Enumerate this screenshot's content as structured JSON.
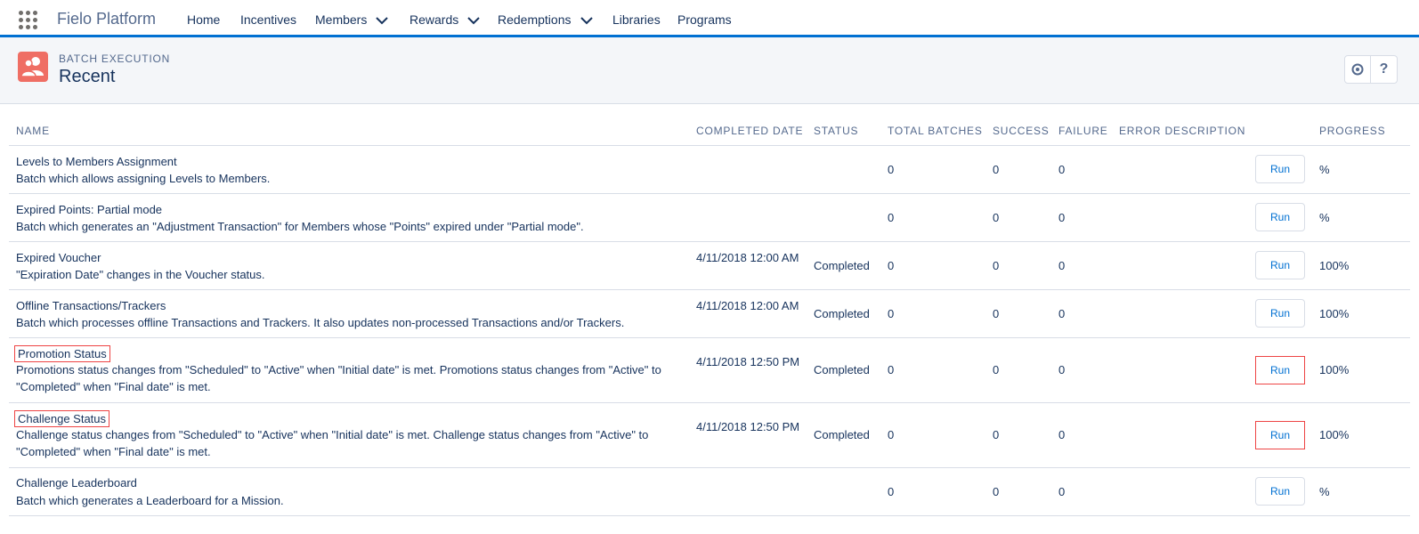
{
  "app": {
    "name": "Fielo Platform"
  },
  "nav": [
    {
      "label": "Home",
      "dropdown": false
    },
    {
      "label": "Incentives",
      "dropdown": false
    },
    {
      "label": "Members",
      "dropdown": true
    },
    {
      "label": "Rewards",
      "dropdown": true
    },
    {
      "label": "Redemptions",
      "dropdown": true
    },
    {
      "label": "Libraries",
      "dropdown": false
    },
    {
      "label": "Programs",
      "dropdown": false
    }
  ],
  "header": {
    "eyebrow": "BATCH EXECUTION",
    "title": "Recent",
    "help_label": "?"
  },
  "columns": {
    "name": "NAME",
    "completed_date": "COMPLETED DATE",
    "status": "STATUS",
    "total_batches": "TOTAL BATCHES",
    "success": "SUCCESS",
    "failure": "FAILURE",
    "error_description": "ERROR DESCRIPTION",
    "progress": "PROGRESS"
  },
  "rows": [
    {
      "name": "Levels to Members Assignment",
      "description": "Batch which allows assigning Levels to Members.",
      "completed_date": "",
      "status": "",
      "total_batches": "0",
      "success": "0",
      "failure": "0",
      "error": "",
      "run_label": "Run",
      "progress": "%",
      "highlighted": false
    },
    {
      "name": "Expired Points: Partial mode",
      "description": "Batch which generates an \"Adjustment Transaction\" for Members whose \"Points\" expired under \"Partial mode\".",
      "completed_date": "",
      "status": "",
      "total_batches": "0",
      "success": "0",
      "failure": "0",
      "error": "",
      "run_label": "Run",
      "progress": "%",
      "highlighted": false
    },
    {
      "name": "Expired Voucher",
      "description": "\"Expiration Date\" changes in the Voucher status.",
      "completed_date": "4/11/2018 12:00 AM",
      "status": "Completed",
      "total_batches": "0",
      "success": "0",
      "failure": "0",
      "error": "",
      "run_label": "Run",
      "progress": "100%",
      "highlighted": false
    },
    {
      "name": "Offline Transactions/Trackers",
      "description": "Batch which processes offline Transactions and Trackers. It also updates non-processed Transactions and/or Trackers.",
      "completed_date": "4/11/2018 12:00 AM",
      "status": "Completed",
      "total_batches": "0",
      "success": "0",
      "failure": "0",
      "error": "",
      "run_label": "Run",
      "progress": "100%",
      "highlighted": false
    },
    {
      "name": "Promotion Status",
      "description": "Promotions status changes from \"Scheduled\" to \"Active\" when \"Initial date\" is met. Promotions status changes from \"Active\" to \"Completed\" when \"Final date\" is met.",
      "completed_date": "4/11/2018 12:50 PM",
      "status": "Completed",
      "total_batches": "0",
      "success": "0",
      "failure": "0",
      "error": "",
      "run_label": "Run",
      "progress": "100%",
      "highlighted": true
    },
    {
      "name": "Challenge Status",
      "description": "Challenge status changes from \"Scheduled\" to \"Active\" when \"Initial date\" is met. Challenge status changes from \"Active\" to \"Completed\" when \"Final date\" is met.",
      "completed_date": "4/11/2018 12:50 PM",
      "status": "Completed",
      "total_batches": "0",
      "success": "0",
      "failure": "0",
      "error": "",
      "run_label": "Run",
      "progress": "100%",
      "highlighted": true
    },
    {
      "name": "Challenge Leaderboard",
      "description": "Batch which generates a Leaderboard for a Mission.",
      "completed_date": "",
      "status": "",
      "total_batches": "0",
      "success": "0",
      "failure": "0",
      "error": "",
      "run_label": "Run",
      "progress": "%",
      "highlighted": false
    }
  ]
}
